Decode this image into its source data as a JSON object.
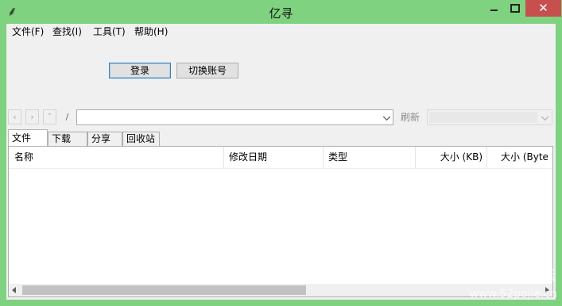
{
  "window": {
    "title": "亿寻",
    "icon": "app-logo-icon",
    "controls": {
      "minimize_icon": "minimize-icon",
      "maximize_icon": "maximize-icon",
      "close_glyph": "✕"
    }
  },
  "menu": [
    {
      "label": "文件(F)"
    },
    {
      "label": "查找(I)"
    },
    {
      "label": "工具(T)"
    },
    {
      "label": "帮助(H)"
    }
  ],
  "account": {
    "login_label": "登录",
    "switch_label": "切换账号"
  },
  "nav": {
    "back_glyph": "‹",
    "forward_glyph": "›",
    "up_glyph": "˄",
    "root_glyph": "/",
    "address_value": "",
    "refresh_label": "刷新",
    "secondary_combo_value": ""
  },
  "tabs": [
    {
      "label": "文件",
      "active": true
    },
    {
      "label": "下载",
      "active": false
    },
    {
      "label": "分享",
      "active": false
    },
    {
      "label": "回收站",
      "active": false
    }
  ],
  "file_list": {
    "columns": [
      "名称",
      "修改日期",
      "类型",
      "大小 (KB)",
      "大小 (Byte"
    ],
    "rows": []
  },
  "watermark": {
    "line1": "吾爱破解论坛",
    "line2": "www.52pojie.cn"
  },
  "colors": {
    "frame": "#7fd27f",
    "close_button": "#c7504f",
    "client_bg": "#f0f0f0"
  }
}
